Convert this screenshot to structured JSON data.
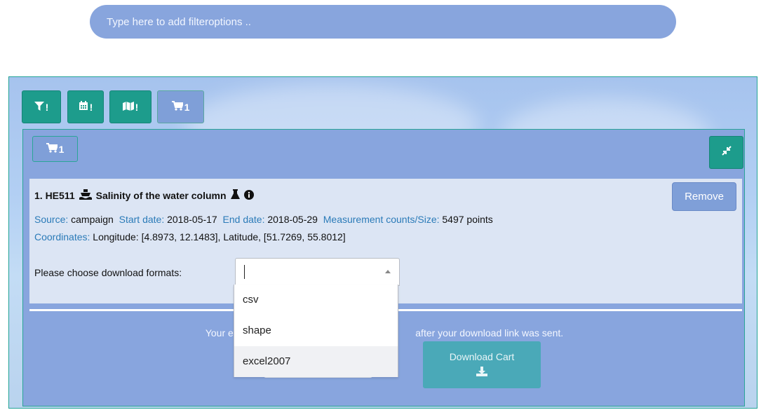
{
  "filter": {
    "placeholder": "Type here to add filteroptions .."
  },
  "tabs": [
    {
      "icon": "filter-icon",
      "badge": "!"
    },
    {
      "icon": "calendar-icon",
      "badge": "!"
    },
    {
      "icon": "map-icon",
      "badge": "!"
    },
    {
      "icon": "cart-icon",
      "badge": "1"
    }
  ],
  "cart": {
    "count": "1",
    "item": {
      "title": "1. HE511",
      "parameter": "Salinity of the water column",
      "source_key": "Source:",
      "source": "campaign",
      "start_key": "Start date:",
      "start": "2018-05-17",
      "end_key": "End date:",
      "end": "2018-05-29",
      "count_key": "Measurement counts/Size:",
      "count": "5497 points",
      "coords_key": "Coordinates:",
      "coords": "Longitude: [4.8973, 12.1483], Latitude, [51.7269, 55.8012]",
      "remove_label": "Remove",
      "format_label": "Please choose download formats:"
    },
    "email_text_left": "Your ema",
    "email_text_right": "after your download link was sent.",
    "download_label": "Download Cart"
  },
  "dropdown": {
    "options": [
      "csv",
      "shape",
      "excel2007"
    ],
    "hovered": "excel2007"
  },
  "colors": {
    "accent": "#1d9c8c",
    "panel": "#88a5de",
    "link": "#2b7bb8"
  }
}
